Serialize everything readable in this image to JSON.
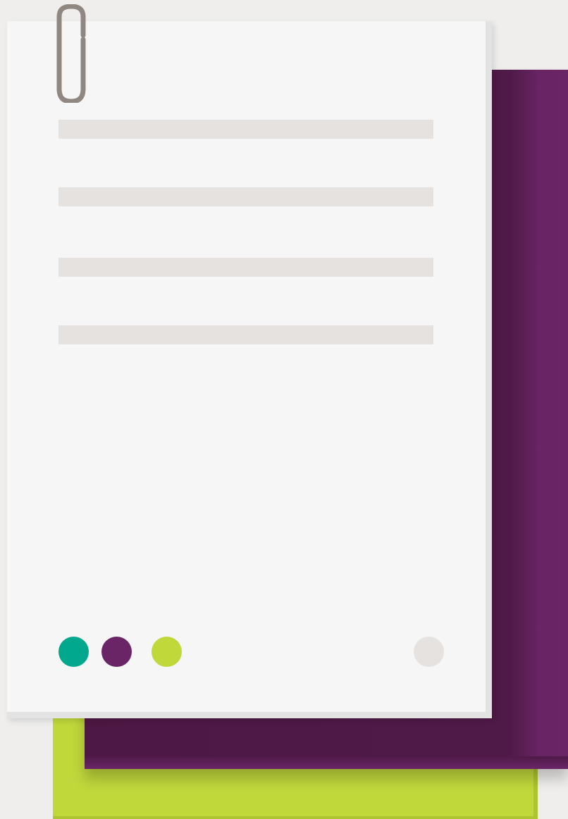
{
  "colors": {
    "background": "#efeeec",
    "paper": "#f6f6f6",
    "paper_edge": "#e3e3e3",
    "placeholder_line": "#e6e2e0",
    "paperclip": "#8f8780",
    "sheet_purple": "#4f1a47",
    "sheet_green": "#c1d83b"
  },
  "document": {
    "placeholder_lines": 4,
    "icons": {
      "paperclip": "paperclip-icon"
    }
  },
  "color_swatches": [
    {
      "name": "teal",
      "color": "#01a88e"
    },
    {
      "name": "purple",
      "color": "#6a2567"
    },
    {
      "name": "lime",
      "color": "#c1d83b"
    }
  ],
  "menu_dot": {
    "color": "#e6e2e0"
  }
}
